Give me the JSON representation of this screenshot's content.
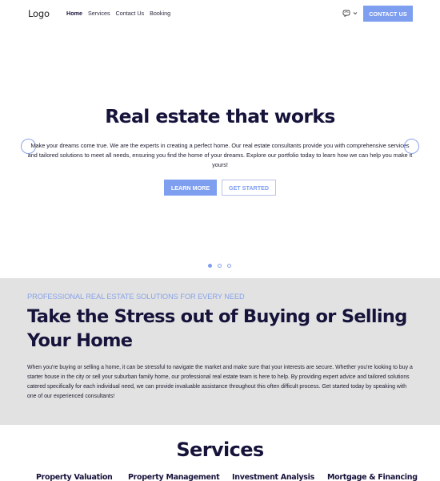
{
  "navbar": {
    "logo": "Logo",
    "links": [
      {
        "label": "Home",
        "active": true
      },
      {
        "label": "Services",
        "active": false
      },
      {
        "label": "Contact Us",
        "active": false
      },
      {
        "label": "Booking",
        "active": false
      }
    ],
    "language_icon": "globe-icon",
    "dropdown_icon": "chevron-down-icon",
    "contact_button": "CONTACT US"
  },
  "hero": {
    "title": "Real estate that works",
    "text": "Make your dreams come true. We are the experts in creating a perfect home. Our real estate consultants provide you with comprehensive services and tailored solutions to meet all needs, ensuring you find the home of your dreams. Explore our portfolio today to learn how we can help you make it yours!",
    "primary_button": "LEARN MORE",
    "secondary_button": "GET STARTED",
    "slides_total": 3,
    "active_slide": 1
  },
  "about": {
    "eyebrow": "PROFESSIONAL REAL ESTATE SOLUTIONS FOR EVERY NEED",
    "title": "Take the Stress out of Buying or Selling Your Home",
    "text": "When you're buying or selling a home, it can be stressful to navigate the market and make sure that your interests are secure. Whether you're looking to buy a starter house in the city or sell your suburban family home, our professional real estate team is here to help. By providing expert advice and tailored solutions catered specifically for each individual need, we can provide invaluable assistance throughout this often difficult process. Get started today by speaking with one of our experienced consultants!"
  },
  "services": {
    "title": "Services",
    "items": [
      {
        "label": "Property Valuation"
      },
      {
        "label": "Property Management"
      },
      {
        "label": "Investment Analysis"
      },
      {
        "label": "Mortgage & Financing"
      }
    ]
  },
  "colors": {
    "accent": "#7e9ef0",
    "heading": "#16133b",
    "section_bg": "#e2e2e2"
  }
}
